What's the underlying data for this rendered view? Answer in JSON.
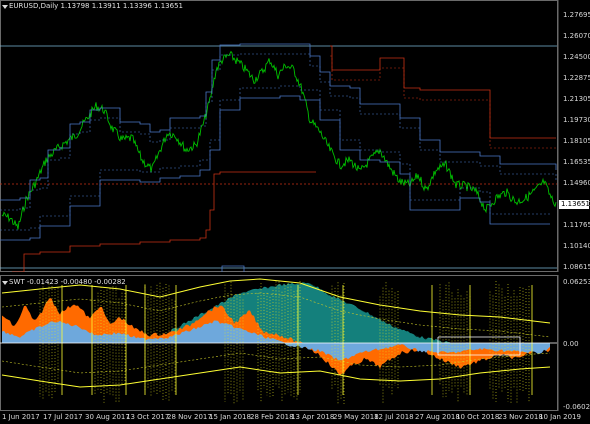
{
  "main_chart": {
    "title": "EURUSD,Daily  1.13798 1.13911 1.13396 1.13651",
    "current_price": "1.13651",
    "price_axis": [
      "1.27695",
      "1.26070",
      "1.24500",
      "1.22875",
      "1.21305",
      "1.19730",
      "1.18105",
      "1.16535",
      "1.14960",
      "1.13340",
      "1.11765",
      "1.10140",
      "1.08615"
    ]
  },
  "sub_chart": {
    "title": "SWT -0.01423 -0.00480 -0.00282",
    "value_axis": [
      "0.06253",
      "0.00",
      "-0.06024"
    ]
  },
  "time_axis": [
    "1 Jun 2017",
    "17 Jul 2017",
    "30 Aug 2017",
    "13 Oct 2017",
    "28 Nov 2017",
    "15 Jan 2018",
    "28 Feb 2018",
    "13 Apr 2018",
    "29 May 2018",
    "12 Jul 2018",
    "27 Aug 2018",
    "10 Oct 2018",
    "23 Nov 2018",
    "10 Jan 2019"
  ],
  "colors": {
    "background": "#000000",
    "price_line": "#00c000",
    "channel_blue": "#4a78c8",
    "channel_red": "#c83214",
    "hist_orange": "#ff6a00",
    "hist_blue": "#6ea8dc",
    "hist_teal": "#1aa6a0",
    "band_yellow": "#ffff33"
  }
}
